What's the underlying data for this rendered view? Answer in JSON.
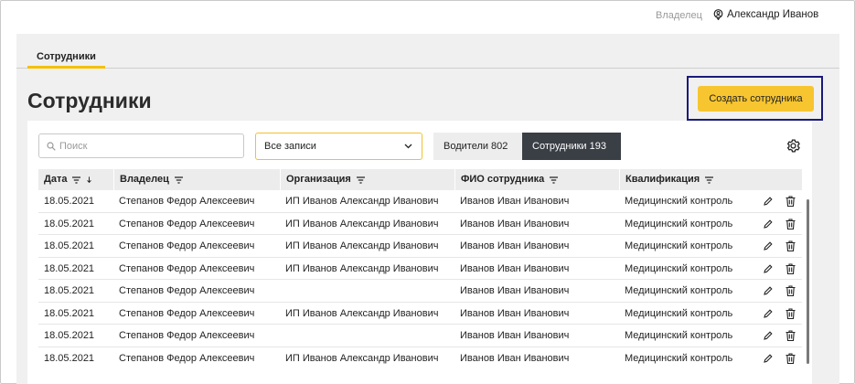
{
  "header": {
    "owner_label": "Владелец",
    "user_name": "Александр Иванов"
  },
  "tabs": [
    {
      "label": "Сотрудники",
      "active": true
    }
  ],
  "page": {
    "title": "Сотрудники",
    "create_button": "Создать сотрудника"
  },
  "filters": {
    "search_placeholder": "Поиск",
    "select_value": "Все записи",
    "segments": [
      {
        "label": "Водители 802",
        "active": false
      },
      {
        "label": "Сотрудники 193",
        "active": true
      }
    ]
  },
  "table": {
    "columns": [
      "Дата",
      "Владелец",
      "Организация",
      "ФИО сотрудника",
      "Квалификация"
    ],
    "rows": [
      {
        "date": "18.05.2021",
        "owner": "Степанов Федор Алексеевич",
        "org": "ИП Иванов Александр Иванович",
        "fio": "Иванов Иван Иванович",
        "qual": "Медицинский контроль"
      },
      {
        "date": "18.05.2021",
        "owner": "Степанов Федор Алексеевич",
        "org": "ИП Иванов Александр Иванович",
        "fio": "Иванов Иван Иванович",
        "qual": "Медицинский контроль"
      },
      {
        "date": "18.05.2021",
        "owner": "Степанов Федор Алексеевич",
        "org": "ИП Иванов Александр Иванович",
        "fio": "Иванов Иван Иванович",
        "qual": "Медицинский контроль"
      },
      {
        "date": "18.05.2021",
        "owner": "Степанов Федор Алексеевич",
        "org": "ИП Иванов Александр Иванович",
        "fio": "Иванов Иван Иванович",
        "qual": "Медицинский контроль"
      },
      {
        "date": "18.05.2021",
        "owner": "Степанов Федор Алексеевич",
        "org": "",
        "fio": "Иванов Иван Иванович",
        "qual": "Медицинский контроль"
      },
      {
        "date": "18.05.2021",
        "owner": "Степанов Федор Алексеевич",
        "org": "ИП Иванов Александр Иванович",
        "fio": "Иванов Иван Иванович",
        "qual": "Медицинский контроль"
      },
      {
        "date": "18.05.2021",
        "owner": "Степанов Федор Алексеевич",
        "org": "",
        "fio": "Иванов Иван Иванович",
        "qual": "Медицинский контроль"
      },
      {
        "date": "18.05.2021",
        "owner": "Степанов Федор Алексеевич",
        "org": "ИП Иванов Александр Иванович",
        "fio": "Иванов Иван Иванович",
        "qual": "Медицинский контроль"
      }
    ]
  },
  "icons": {
    "user": "user-pin-icon",
    "search": "search-icon",
    "dropdown": "chevron-down-icon",
    "settings": "gear-icon",
    "filter": "filter-icon",
    "sort": "sort-down-icon",
    "edit": "pencil-icon",
    "delete": "trash-icon"
  },
  "colors": {
    "accent": "#f7c530",
    "segment_active": "#3a3f46",
    "focus_outline": "#1a1a7a"
  }
}
